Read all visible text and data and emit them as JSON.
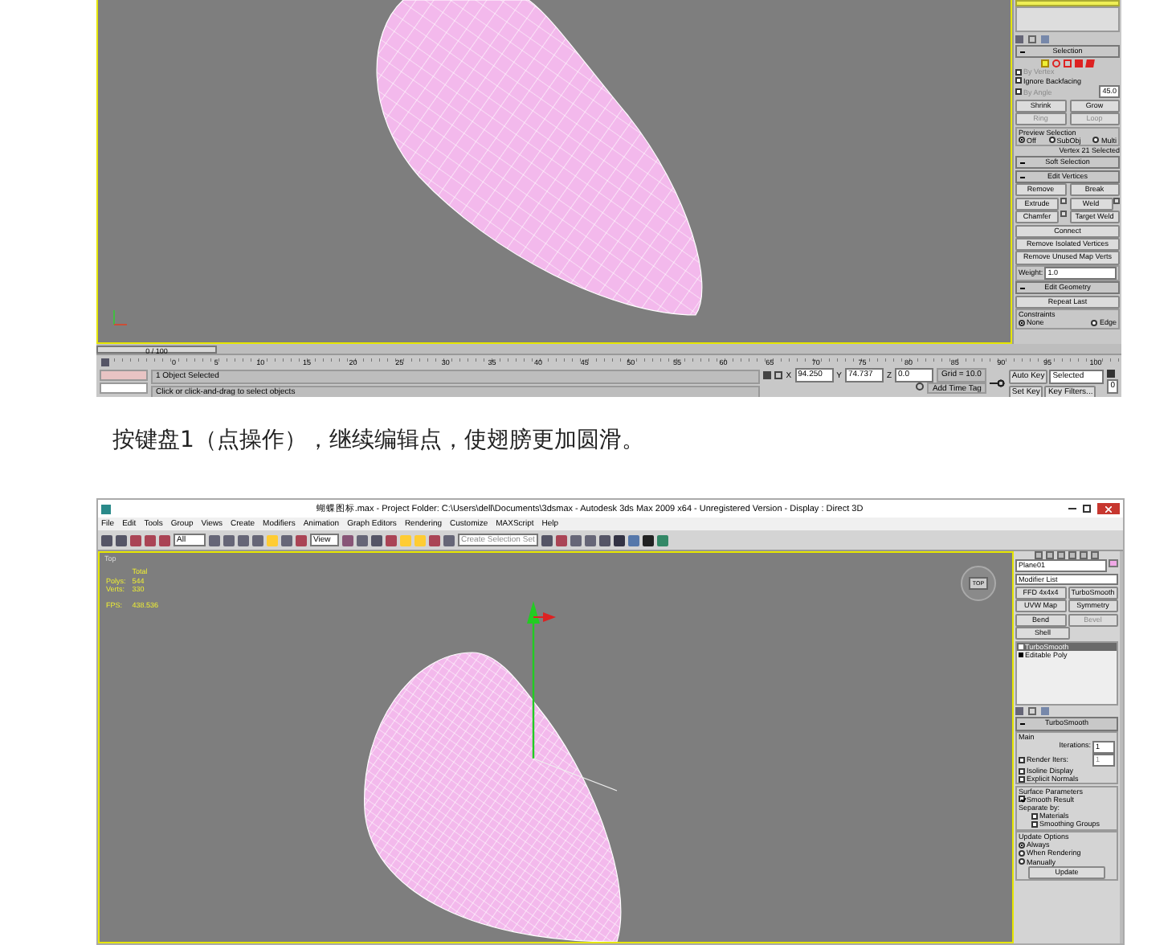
{
  "top_screenshot": {
    "time_slider": {
      "label": "0 / 100"
    },
    "ruler": [
      "0",
      "5",
      "10",
      "15",
      "20",
      "25",
      "30",
      "35",
      "40",
      "45",
      "50",
      "55",
      "60",
      "65",
      "70",
      "75",
      "80",
      "85",
      "90",
      "95",
      "100"
    ],
    "status": {
      "selection": "1 Object Selected",
      "prompt": "Click or click-and-drag to select objects",
      "coords": [
        {
          "axis": "X",
          "value": "94.250"
        },
        {
          "axis": "Y",
          "value": "74.737"
        },
        {
          "axis": "Z",
          "value": "0.0"
        }
      ],
      "grid": "Grid = 10.0",
      "add_time_tag": "Add Time Tag",
      "auto_key": "Auto Key",
      "key_mode": "Selected",
      "set_key": "Set Key",
      "key_filters": "Key Filters...",
      "frame": "0"
    },
    "panel": {
      "selection": {
        "title": "Selection",
        "checks": [
          {
            "label": "By Vertex",
            "checked": false,
            "disabled": true
          },
          {
            "label": "Ignore Backfacing",
            "checked": false,
            "disabled": false
          },
          {
            "label": "By Angle",
            "checked": false,
            "disabled": true,
            "value": "45.0"
          }
        ],
        "buttons": [
          {
            "label": "Shrink",
            "disabled": false
          },
          {
            "label": "Grow",
            "disabled": false
          },
          {
            "label": "Ring",
            "disabled": true
          },
          {
            "label": "Loop",
            "disabled": true
          }
        ],
        "preview": {
          "title": "Preview Selection",
          "options": [
            {
              "label": "Off",
              "selected": true
            },
            {
              "label": "SubObj",
              "selected": false
            },
            {
              "label": "Multi",
              "selected": false
            }
          ]
        },
        "info": "Vertex 21 Selected"
      },
      "soft_selection": {
        "title": "Soft Selection"
      },
      "edit_vertices": {
        "title": "Edit Vertices",
        "buttons": [
          {
            "label": "Remove",
            "settings": false
          },
          {
            "label": "Break",
            "settings": false
          },
          {
            "label": "Extrude",
            "settings": true
          },
          {
            "label": "Weld",
            "settings": true
          },
          {
            "label": "Chamfer",
            "settings": true
          },
          {
            "label": "Target Weld",
            "settings": false
          }
        ],
        "wide_buttons": [
          "Connect",
          "Remove Isolated Vertices",
          "Remove Unused Map Verts"
        ],
        "weight": {
          "label": "Weight:",
          "value": "1.0"
        }
      },
      "edit_geometry": {
        "title": "Edit Geometry",
        "button": "Repeat Last",
        "constraints": {
          "title": "Constraints",
          "options": [
            {
              "label": "None",
              "selected": true
            },
            {
              "label": "Edge",
              "selected": false
            }
          ]
        }
      }
    }
  },
  "caption": "按键盘1（点操作），继续编辑点，使翅膀更加圆滑。",
  "bottom_screenshot": {
    "title": "蝴蝶图标.max    - Project Folder: C:\\Users\\dell\\Documents\\3dsmax    - Autodesk 3ds Max  2009 x64    - Unregistered Version    - Display : Direct 3D",
    "menu": [
      "File",
      "Edit",
      "Tools",
      "Group",
      "Views",
      "Create",
      "Modifiers",
      "Animation",
      "Graph Editors",
      "Rendering",
      "Customize",
      "MAXScript",
      "Help"
    ],
    "toolbar": {
      "filter": "All",
      "coord_system": "View",
      "selection_set": "Create Selection Set"
    },
    "viewport": {
      "label": "Top",
      "stats_header": "Total",
      "stats": [
        {
          "label": "Polys:",
          "value": "544"
        },
        {
          "label": "Verts:",
          "value": "330"
        }
      ],
      "fps": {
        "label": "FPS:",
        "value": "438.536"
      },
      "viewcube": "TOP"
    },
    "panel": {
      "object_name": "Plane01",
      "modifier_list": "Modifier List",
      "modifier_buttons": [
        {
          "label": "FFD 4x4x4",
          "disabled": false
        },
        {
          "label": "TurboSmooth",
          "disabled": false
        },
        {
          "label": "UVW Map",
          "disabled": false
        },
        {
          "label": "Symmetry",
          "disabled": false
        },
        {
          "label": "Bend",
          "disabled": false
        },
        {
          "label": "Bevel",
          "disabled": true
        },
        {
          "label": "Shell",
          "disabled": false
        }
      ],
      "stack": [
        {
          "label": "TurboSmooth",
          "selected": true
        },
        {
          "label": "Editable Poly",
          "selected": false
        }
      ],
      "rollout": {
        "title": "TurboSmooth",
        "main": {
          "title": "Main",
          "iterations": {
            "label": "Iterations:",
            "value": "1"
          },
          "render_iters": {
            "label": "Render Iters:",
            "value": "1",
            "checked": false
          },
          "checks": [
            {
              "label": "Isoline Display",
              "checked": false
            },
            {
              "label": "Explicit Normals",
              "checked": false
            }
          ]
        },
        "surface": {
          "title": "Surface Parameters",
          "smooth_result": {
            "label": "Smooth Result",
            "checked": true
          },
          "separate_by": "Separate by:",
          "checks": [
            {
              "label": "Materials",
              "checked": false
            },
            {
              "label": "Smoothing Groups",
              "checked": false
            }
          ]
        },
        "update": {
          "title": "Update Options",
          "options": [
            {
              "label": "Always",
              "selected": true
            },
            {
              "label": "When Rendering",
              "selected": false
            },
            {
              "label": "Manually",
              "selected": false
            }
          ],
          "button": "Update"
        }
      }
    }
  }
}
